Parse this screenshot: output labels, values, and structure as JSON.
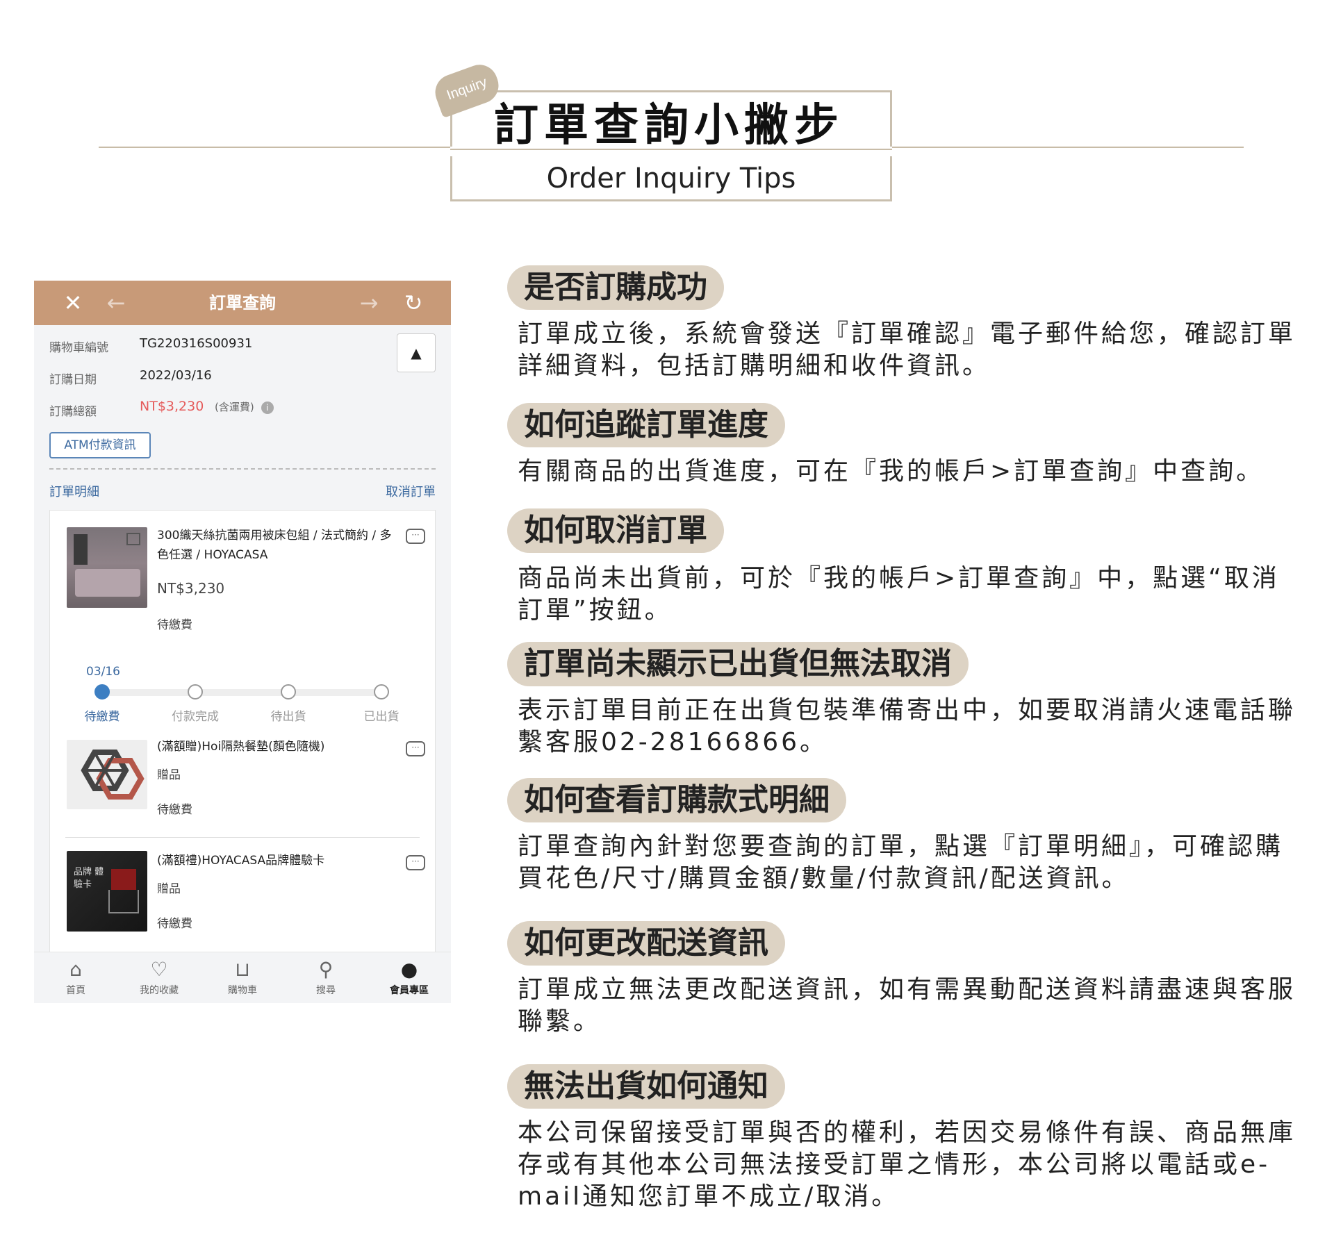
{
  "header": {
    "tag": "Inquiry",
    "title_cn": "訂單查詢小撇步",
    "title_en": "Order Inquiry Tips"
  },
  "phone": {
    "topbar": {
      "close_icon": "close-icon",
      "back_icon": "arrow-left-icon",
      "title": "訂單查詢",
      "forward_icon": "arrow-right-icon",
      "refresh_icon": "refresh-icon"
    },
    "order_info": {
      "cart_no_label": "購物車編號",
      "cart_no_value": "TG220316S00931",
      "date_label": "訂購日期",
      "date_value": "2022/03/16",
      "total_label": "訂購總額",
      "total_value": "NT$3,230",
      "total_note": "(含運費)",
      "collapse_icon": "caret-up-icon"
    },
    "atm_button": "ATM付款資訊",
    "detail_link": "訂單明細",
    "cancel_link": "取消訂單",
    "items": [
      {
        "name": "300織天絲抗菌兩用被床包組 / 法式簡約 / 多色任選 / HOYACASA",
        "price": "NT$3,230",
        "status": "待繳費"
      },
      {
        "name": "(滿額贈)Hoi隔熱餐墊(顏色隨機)",
        "sub": "贈品",
        "status": "待繳費"
      },
      {
        "name": "(滿額禮)HOYACASA品牌體驗卡",
        "sub": "贈品",
        "status": "待繳費",
        "thumb_text": "品牌 體驗卡"
      }
    ],
    "progress": {
      "date": "03/16",
      "steps": [
        "待繳費",
        "付款完成",
        "待出貨",
        "已出貨"
      ],
      "current_step": 0
    },
    "tabbar": [
      {
        "label": "首頁",
        "icon": "home-icon"
      },
      {
        "label": "我的收藏",
        "icon": "heart-icon"
      },
      {
        "label": "購物車",
        "icon": "cart-icon"
      },
      {
        "label": "搜尋",
        "icon": "search-icon"
      },
      {
        "label": "會員專區",
        "icon": "user-icon"
      }
    ]
  },
  "faq": [
    {
      "q": "是否訂購成功",
      "a": "訂單成立後，系統會發送『訂單確認』電子郵件給您，確認訂單詳細資料，包括訂購明細和收件資訊。"
    },
    {
      "q": "如何追蹤訂單進度",
      "a": "有關商品的出貨進度，可在『我的帳戶>訂單查詢』中查詢。"
    },
    {
      "q": "如何取消訂單",
      "a": "商品尚未出貨前，可於『我的帳戶>訂單查詢』中，點選“取消訂單”按鈕。"
    },
    {
      "q": "訂單尚未顯示已出貨但無法取消",
      "a": "表示訂單目前正在出貨包裝準備寄出中，如要取消請火速電話聯繫客服02-28166866。"
    },
    {
      "q": "如何查看訂購款式明細",
      "a": "訂單查詢內針對您要查詢的訂單，點選『訂單明細』，可確認購買花色/尺寸/購買金額/數量/付款資訊/配送資訊。"
    },
    {
      "q": "如何更改配送資訊",
      "a": "訂單成立無法更改配送資訊，如有需異動配送資料請盡速與客服聯繫。"
    },
    {
      "q": "無法出貨如何通知",
      "a": "本公司保留接受訂單與否的權利，若因交易條件有誤、商品無庫存或有其他本公司無法接受訂單之情形，本公司將以電話或e-mail通知您訂單不成立/取消。"
    }
  ]
}
